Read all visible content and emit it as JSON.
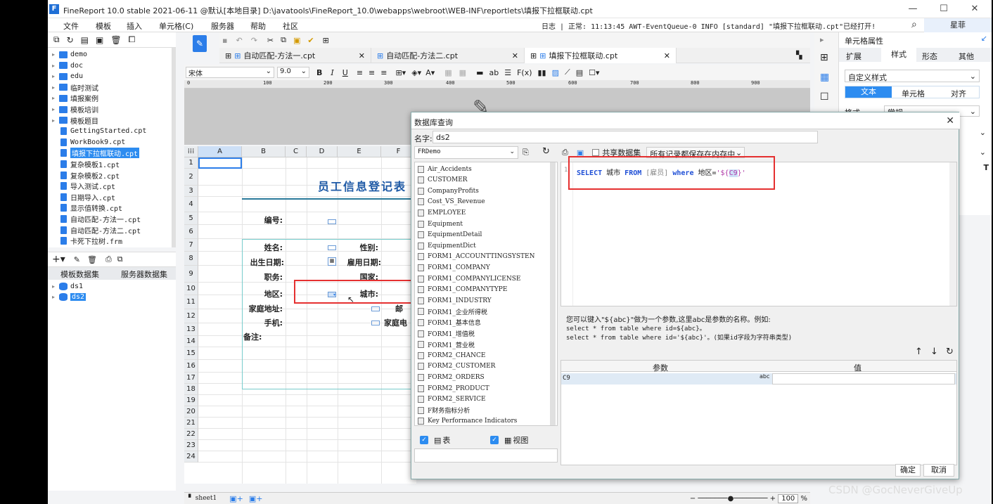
{
  "window": {
    "title": "FineReport 10.0 stable 2021-06-11 @默认[本地目录]   D:\\javatools\\FineReport_10.0\\webapps\\webroot\\WEB-INF\\reportlets\\填报下拉框联动.cpt",
    "min": "—",
    "max": "☐",
    "close": "✕"
  },
  "menu": {
    "items": [
      "文件",
      "模板",
      "插入",
      "单元格(C)",
      "服务器",
      "帮助",
      "社区"
    ],
    "log": "日志 | 正常: 11:13:45 AWT-EventQueue-0 INFO [standard] \"填报下拉框联动.cpt\"已经打开!",
    "user": "星菲"
  },
  "tree": [
    {
      "type": "folder",
      "label": "demo"
    },
    {
      "type": "folder",
      "label": "doc"
    },
    {
      "type": "folder",
      "label": "edu"
    },
    {
      "type": "folder",
      "label": "临时测试"
    },
    {
      "type": "folder",
      "label": "填报案例"
    },
    {
      "type": "folder",
      "label": "模板培训"
    },
    {
      "type": "folder",
      "label": "模板题目"
    },
    {
      "type": "file",
      "label": "GettingStarted.cpt"
    },
    {
      "type": "file",
      "label": "WorkBook9.cpt"
    },
    {
      "type": "file",
      "label": "填报下拉框联动.cpt",
      "selected": true
    },
    {
      "type": "file",
      "label": "复杂模板1.cpt"
    },
    {
      "type": "file",
      "label": "复杂模板2.cpt"
    },
    {
      "type": "file",
      "label": "导入测试.cpt"
    },
    {
      "type": "file",
      "label": "日期导入.cpt"
    },
    {
      "type": "file",
      "label": "显示值转换.cpt"
    },
    {
      "type": "file",
      "label": "自动匹配-方法一.cpt"
    },
    {
      "type": "file",
      "label": "自动匹配-方法二.cpt"
    },
    {
      "type": "file",
      "label": "卡死下拉树.frm"
    }
  ],
  "datasets": {
    "tab_template": "模板数据集",
    "tab_server": "服务器数据集",
    "items": [
      "ds1",
      "ds2"
    ]
  },
  "fileTabs": [
    "自动匹配-方法一.cpt",
    "自动匹配-方法二.cpt",
    "填报下拉框联动.cpt"
  ],
  "fontbar": {
    "font": "宋体",
    "size": "9.0"
  },
  "ruler": [
    "0",
    "100",
    "200",
    "300",
    "400",
    "500",
    "600",
    "700",
    "800",
    "900"
  ],
  "sheet": {
    "columns": [
      "A",
      "B",
      "C",
      "D",
      "E",
      "F"
    ],
    "rows": [
      "1",
      "2",
      "3",
      "4",
      "5",
      "6",
      "7",
      "8",
      "9",
      "10",
      "11",
      "12",
      "13",
      "14",
      "15",
      "16",
      "17",
      "18",
      "19",
      "20",
      "21",
      "22",
      "23",
      "24"
    ],
    "title": "员工信息登记表",
    "labels": {
      "num": "编号:",
      "name": "姓名:",
      "gender": "性别:",
      "birth": "出生日期:",
      "hire": "雇用日期:",
      "job": "职务:",
      "country": "国家:",
      "region": "地区:",
      "city": "城市:",
      "address": "家庭地址:",
      "mobile": "手机:",
      "note": "备注:",
      "mail": "邮",
      "homephone": "家庭电"
    },
    "sheet_name": "sheet1",
    "zoom": "100",
    "zoom_unit": "%"
  },
  "rightPanel": {
    "title": "单元格属性",
    "tabs": [
      "扩展",
      "样式",
      "形态",
      "其他"
    ],
    "style_select": "自定义样式",
    "subtabs": [
      "文本",
      "单元格",
      "对齐"
    ],
    "format_label": "格式",
    "format_value": "常规"
  },
  "dialog": {
    "title": "数据库查询",
    "name_label": "名字:",
    "name_value": "ds2",
    "connection": "FRDemo",
    "share_label": "共享数据集",
    "save_mode": "所有记录都保存在内存中",
    "line_no": "1",
    "sql": {
      "kw1": "SELECT",
      "t1": " 城市 ",
      "kw2": "FROM",
      "t2": " [雇员] ",
      "kw3": "where",
      "t3": " 地区=",
      "str": "'${",
      "cursor": "C9",
      "end": "}'"
    },
    "tables": [
      "Air_Accidents",
      "CUSTOMER",
      "CompanyProfits",
      "Cost_VS_Revenue",
      "EMPLOYEE",
      "Equipment",
      "EquipmentDetail",
      "EquipmentDict",
      "FORM1_ACCOUNTTINGSYSTEN",
      "FORM1_COMPANY",
      "FORM1_COMPANYLICENSE",
      "FORM1_COMPANYTYPE",
      "FORM1_INDUSTRY",
      "FORM1_企业所得税",
      "FORM1_基本信息",
      "FORM1_增值税",
      "FORM1_营业税",
      "FORM2_CHANCE",
      "FORM2_CUSTOMER",
      "FORM2_ORDERS",
      "FORM2_PRODUCT",
      "FORM2_SERVICE",
      "F财务指标分析",
      "Key Performance Indicators"
    ],
    "check_table": "表",
    "check_view": "视图",
    "hint1": "您可以键入\"${abc}\"做为一个参数,这里abc是参数的名称。例如:",
    "hint2": "select * from table where id=${abc}。",
    "hint3": "select * from table where id='${abc}'。(如果id字段为字符串类型)",
    "param_header": "参数",
    "value_header": "值",
    "param_name": "C9",
    "ok": "确定",
    "cancel": "取消"
  },
  "watermark": "CSDN @GocNeverGiveUp"
}
